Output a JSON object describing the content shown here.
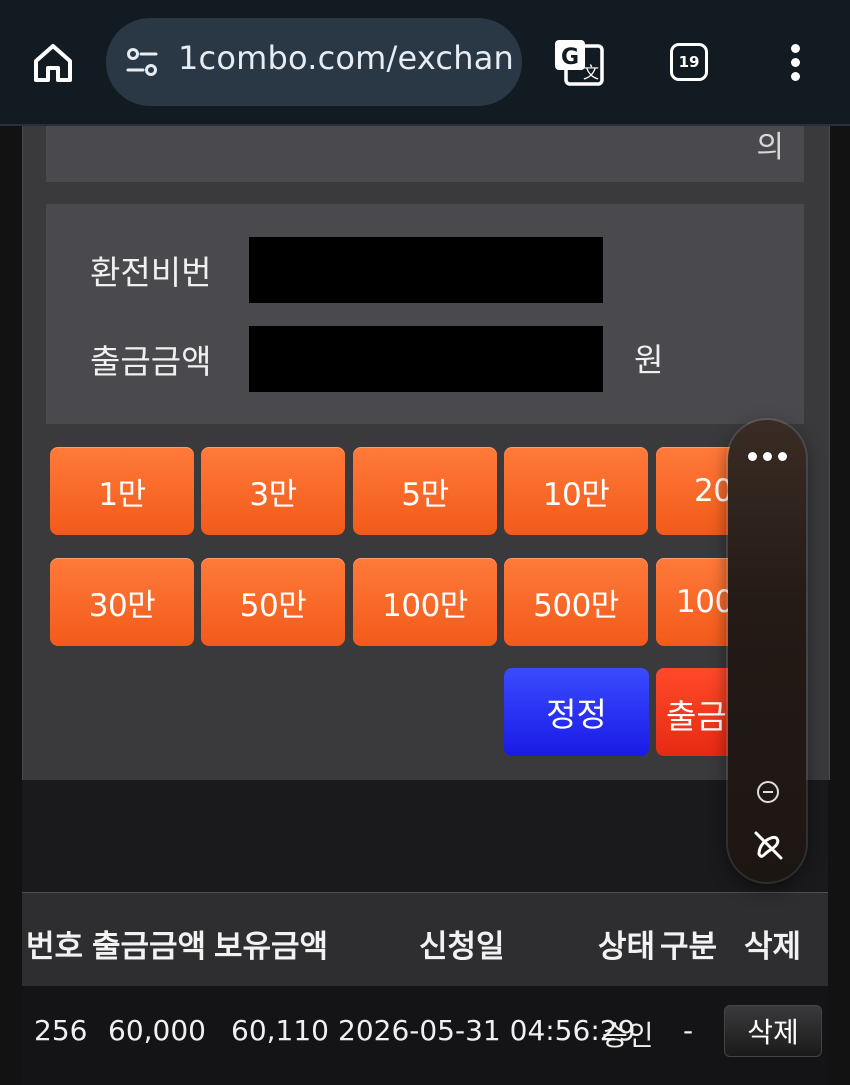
{
  "browser": {
    "url": "1combo.com/exchan",
    "tab_count": "19"
  },
  "top_box": {
    "glyph": "의"
  },
  "form": {
    "password_label": "환전비번",
    "amount_label": "출금금액",
    "unit": "원"
  },
  "amount_buttons_row1": [
    "1만",
    "3만",
    "5만",
    "10만",
    "20"
  ],
  "amount_buttons_row2": [
    "30만",
    "50만",
    "100만",
    "500만",
    "100"
  ],
  "actions": {
    "fix": "정정",
    "withdraw": "출금"
  },
  "table": {
    "headers": [
      "번호",
      "출금금액",
      "보유금액",
      "신청일",
      "상태",
      "구분",
      "삭제"
    ],
    "rows": [
      {
        "no": "256",
        "withdraw": "60,000",
        "balance": "60,110",
        "date": "2026-05-31 04:56:29",
        "status": "승인",
        "type": "-",
        "delete": "삭제"
      }
    ]
  },
  "colors": {
    "amount_button": "#f25a1a",
    "fix_button": "#1a1ae6",
    "withdraw_button": "#e62a12",
    "panel": "#3a3a3d"
  }
}
